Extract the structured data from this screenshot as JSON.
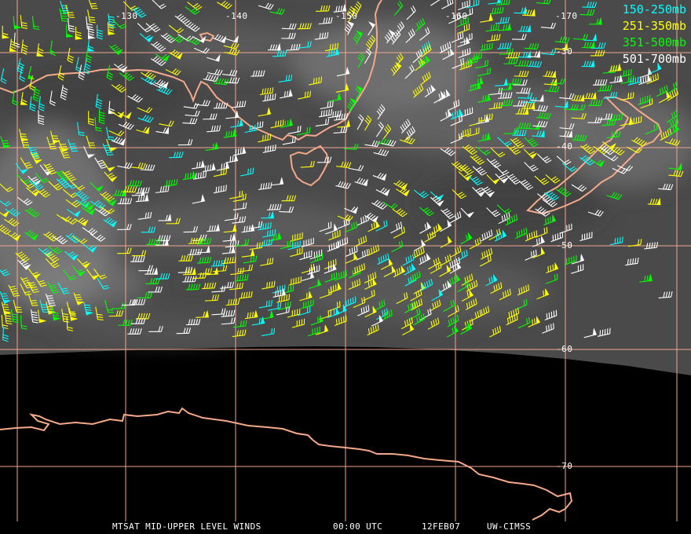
{
  "map": {
    "longitude_labels": [
      "-130",
      "-140",
      "-150",
      "-160",
      "-170"
    ],
    "latitude_labels": [
      "-30",
      "-40",
      "-50",
      "-60",
      "-70"
    ],
    "colors": {
      "graticule": "#f0a890",
      "coastline": "#f4a98a",
      "no_data": "#000000"
    },
    "imagery": "water-vapor-satellite-image",
    "features": [
      "australia-coastline",
      "tasmania-coastline",
      "new-zealand-coastline",
      "antarctica-coastline"
    ]
  },
  "legend": {
    "items": [
      {
        "label": "150-250mb",
        "color": "#00ffff"
      },
      {
        "label": "251-350mb",
        "color": "#ffff00"
      },
      {
        "label": "351-500mb",
        "color": "#00ff00"
      },
      {
        "label": "501-700mb",
        "color": "#ffffff"
      }
    ]
  },
  "footer": {
    "title": "MTSAT MID-UPPER LEVEL WINDS",
    "time": "00:00 UTC",
    "date": "12FEB07",
    "credit": "UW-CIMSS"
  },
  "wind_barb_icon": "wind-barb-icon"
}
